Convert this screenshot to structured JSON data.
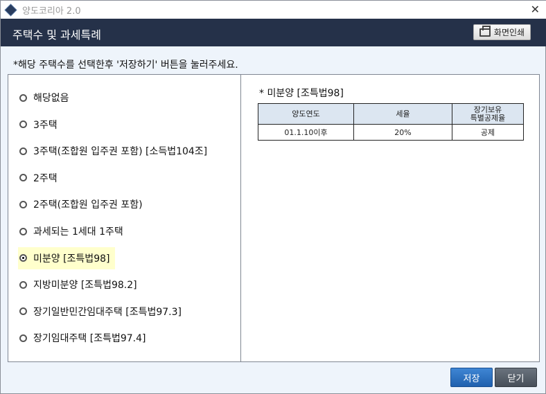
{
  "window": {
    "title": "양도코리아 2.0",
    "close": "✕"
  },
  "header": {
    "title": "주택수 및 과세특례",
    "print_label": "화면인쇄"
  },
  "instruction": "*해당 주택수를 선택한후 '저장하기' 버튼을 눌러주세요.",
  "options": [
    {
      "label": "해당없음",
      "selected": false
    },
    {
      "label": "3주택",
      "selected": false
    },
    {
      "label": "3주택(조합원 입주권 포함) [소득법104조]",
      "selected": false
    },
    {
      "label": "2주택",
      "selected": false
    },
    {
      "label": "2주택(조합원 입주권 포함)",
      "selected": false
    },
    {
      "label": "과세되는 1세대 1주택",
      "selected": false
    },
    {
      "label": "미분양 [조특법98]",
      "selected": true
    },
    {
      "label": "지방미분양 [조특법98.2]",
      "selected": false
    },
    {
      "label": "장기일반민간임대주택 [조특법97.3]",
      "selected": false
    },
    {
      "label": "장기임대주택 [조특법97.4]",
      "selected": false
    }
  ],
  "detail": {
    "title": "* 미분양 [조특법98]",
    "headers": [
      "양도연도",
      "세율",
      "장기보유\n특별공제율"
    ],
    "rows": [
      [
        "01.1.10이후",
        "20%",
        "공제"
      ]
    ]
  },
  "footer": {
    "save": "저장",
    "close": "닫기"
  }
}
